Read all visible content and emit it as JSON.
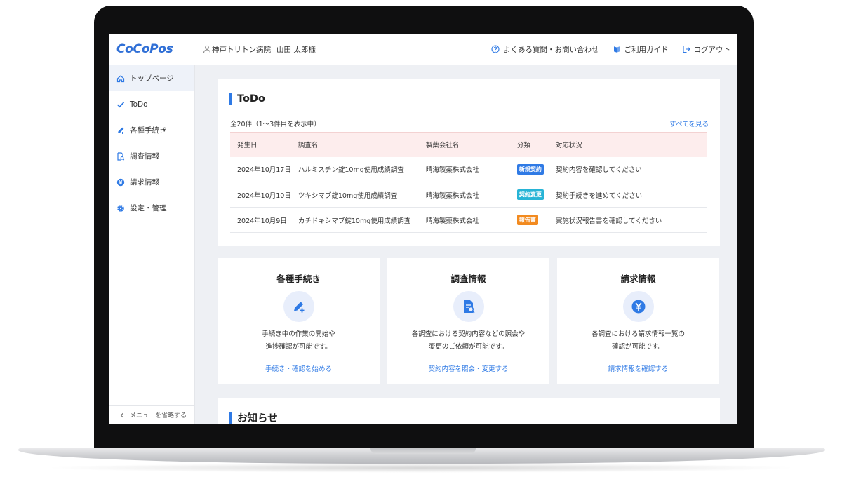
{
  "header": {
    "logo": "CoCoPos",
    "user": {
      "hospital": "神戸トリトン病院",
      "name": "山田 太郎様"
    },
    "nav": [
      {
        "label": "よくある質問・お問い合わせ",
        "icon": "help-circle-icon"
      },
      {
        "label": "ご利用ガイド",
        "icon": "guide-book-icon"
      },
      {
        "label": "ログアウト",
        "icon": "logout-icon"
      }
    ]
  },
  "sidebar": {
    "items": [
      {
        "label": "トップページ",
        "icon": "home-icon",
        "active": true
      },
      {
        "label": "ToDo",
        "icon": "check-icon"
      },
      {
        "label": "各種手続き",
        "icon": "pen-icon"
      },
      {
        "label": "調査情報",
        "icon": "document-search-icon"
      },
      {
        "label": "請求情報",
        "icon": "yen-icon"
      },
      {
        "label": "設定・管理",
        "icon": "gear-icon"
      }
    ],
    "collapse_label": "メニューを省略する"
  },
  "todo": {
    "title": "ToDo",
    "count_text": "全20件（1〜3件目を表示中）",
    "see_all": "すべてを見る",
    "columns": [
      "発生日",
      "調査名",
      "製薬会社名",
      "分類",
      "対応状況"
    ],
    "rows": [
      {
        "date": "2024年10月17日",
        "survey": "ハルミスチン錠10mg使用成績調査",
        "company": "晴海製薬株式会社",
        "category": "新規契約",
        "category_color": "#2f7ae5",
        "status": "契約内容を確認してください"
      },
      {
        "date": "2024年10月10日",
        "survey": "ツキシマブ錠10mg使用成績調査",
        "company": "晴海製薬株式会社",
        "category": "契約変更",
        "category_color": "#27b4d6",
        "status": "契約手続きを進めてください"
      },
      {
        "date": "2024年10月9日",
        "survey": "カチドキシマブ錠10mg使用成績調査",
        "company": "晴海製薬株式会社",
        "category": "報告書",
        "category_color": "#f28a1f",
        "status": "実施状況報告書を確認してください"
      }
    ]
  },
  "features": [
    {
      "title": "各種手続き",
      "icon": "pen-plus-icon",
      "desc1": "手続き中の作業の開始や",
      "desc2": "進捗確認が可能です。",
      "link": "手続き・確認を始める"
    },
    {
      "title": "調査情報",
      "icon": "document-search-icon",
      "desc1": "各調査における契約内容などの照会や",
      "desc2": "変更のご依頼が可能です。",
      "link": "契約内容を照会・変更する"
    },
    {
      "title": "請求情報",
      "icon": "yen-icon",
      "desc1": "各調査における請求情報一覧の",
      "desc2": "確認が可能です。",
      "link": "請求情報を確認する"
    }
  ],
  "news": {
    "title": "お知らせ"
  },
  "colors": {
    "accent": "#2f7ae5",
    "logo": "#2f6fd6",
    "table_header_bg": "#fdeded"
  }
}
